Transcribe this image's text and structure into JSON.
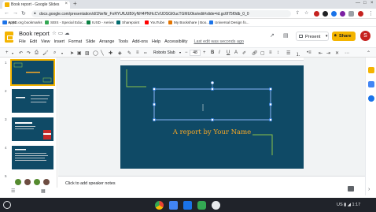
{
  "browser": {
    "tab_title": "Book report - Google Slides",
    "tab_close": "×",
    "new_tab": "+",
    "url": "docs.google.com/presentation/d/1NeNr_FoRYUfUUBXyNH4PNHcCVUDSGI0ucTGMU0ks/edit#slide=id.gc6f75f0db_0_0",
    "bookmarks": [
      {
        "label": "Apps",
        "color": "#4285f4"
      },
      {
        "label": "IUSD.org bookmarks",
        "color": "#1a73e8"
      },
      {
        "label": "SEIS - Special Educ...",
        "color": "#34a853"
      },
      {
        "label": "IUSD - Aeries",
        "color": "#0b8043"
      },
      {
        "label": "Sharepoint",
        "color": "#036c70"
      },
      {
        "label": "YouTube",
        "color": "#ff0000"
      },
      {
        "label": "My Bookshare | Boo...",
        "color": "#e37400"
      },
      {
        "label": "Universal Design fo...",
        "color": "#1a73e8"
      }
    ]
  },
  "doc": {
    "title": "Book report",
    "menu": [
      "File",
      "Edit",
      "View",
      "Insert",
      "Format",
      "Slide",
      "Arrange",
      "Tools",
      "Add-ons",
      "Help",
      "Accessibility"
    ],
    "last_edit": "Last edit was seconds ago",
    "present_label": "Present",
    "share_label": "Share",
    "avatar_letter": "S"
  },
  "toolbar": {
    "font_name": "Roboto Slab",
    "font_size": "48",
    "bold": "B",
    "italic": "I",
    "underline": "U",
    "text_color": "A"
  },
  "slides": [
    {
      "number": "1",
      "selected": true
    },
    {
      "number": "2",
      "selected": false
    },
    {
      "number": "3",
      "selected": false
    },
    {
      "number": "4",
      "selected": false
    },
    {
      "number": "5",
      "selected": false
    }
  ],
  "slide": {
    "subtitle": "A report by Your Name",
    "background_color": "#0f4a66",
    "accent_color": "#8bc34a",
    "title_color": "#f9a825"
  },
  "notes": {
    "placeholder": "Click to add speaker notes"
  },
  "system": {
    "locale": "US",
    "time": "1:17"
  },
  "colors": {
    "brand": "#f4b400",
    "avatar": "#c5221f"
  }
}
